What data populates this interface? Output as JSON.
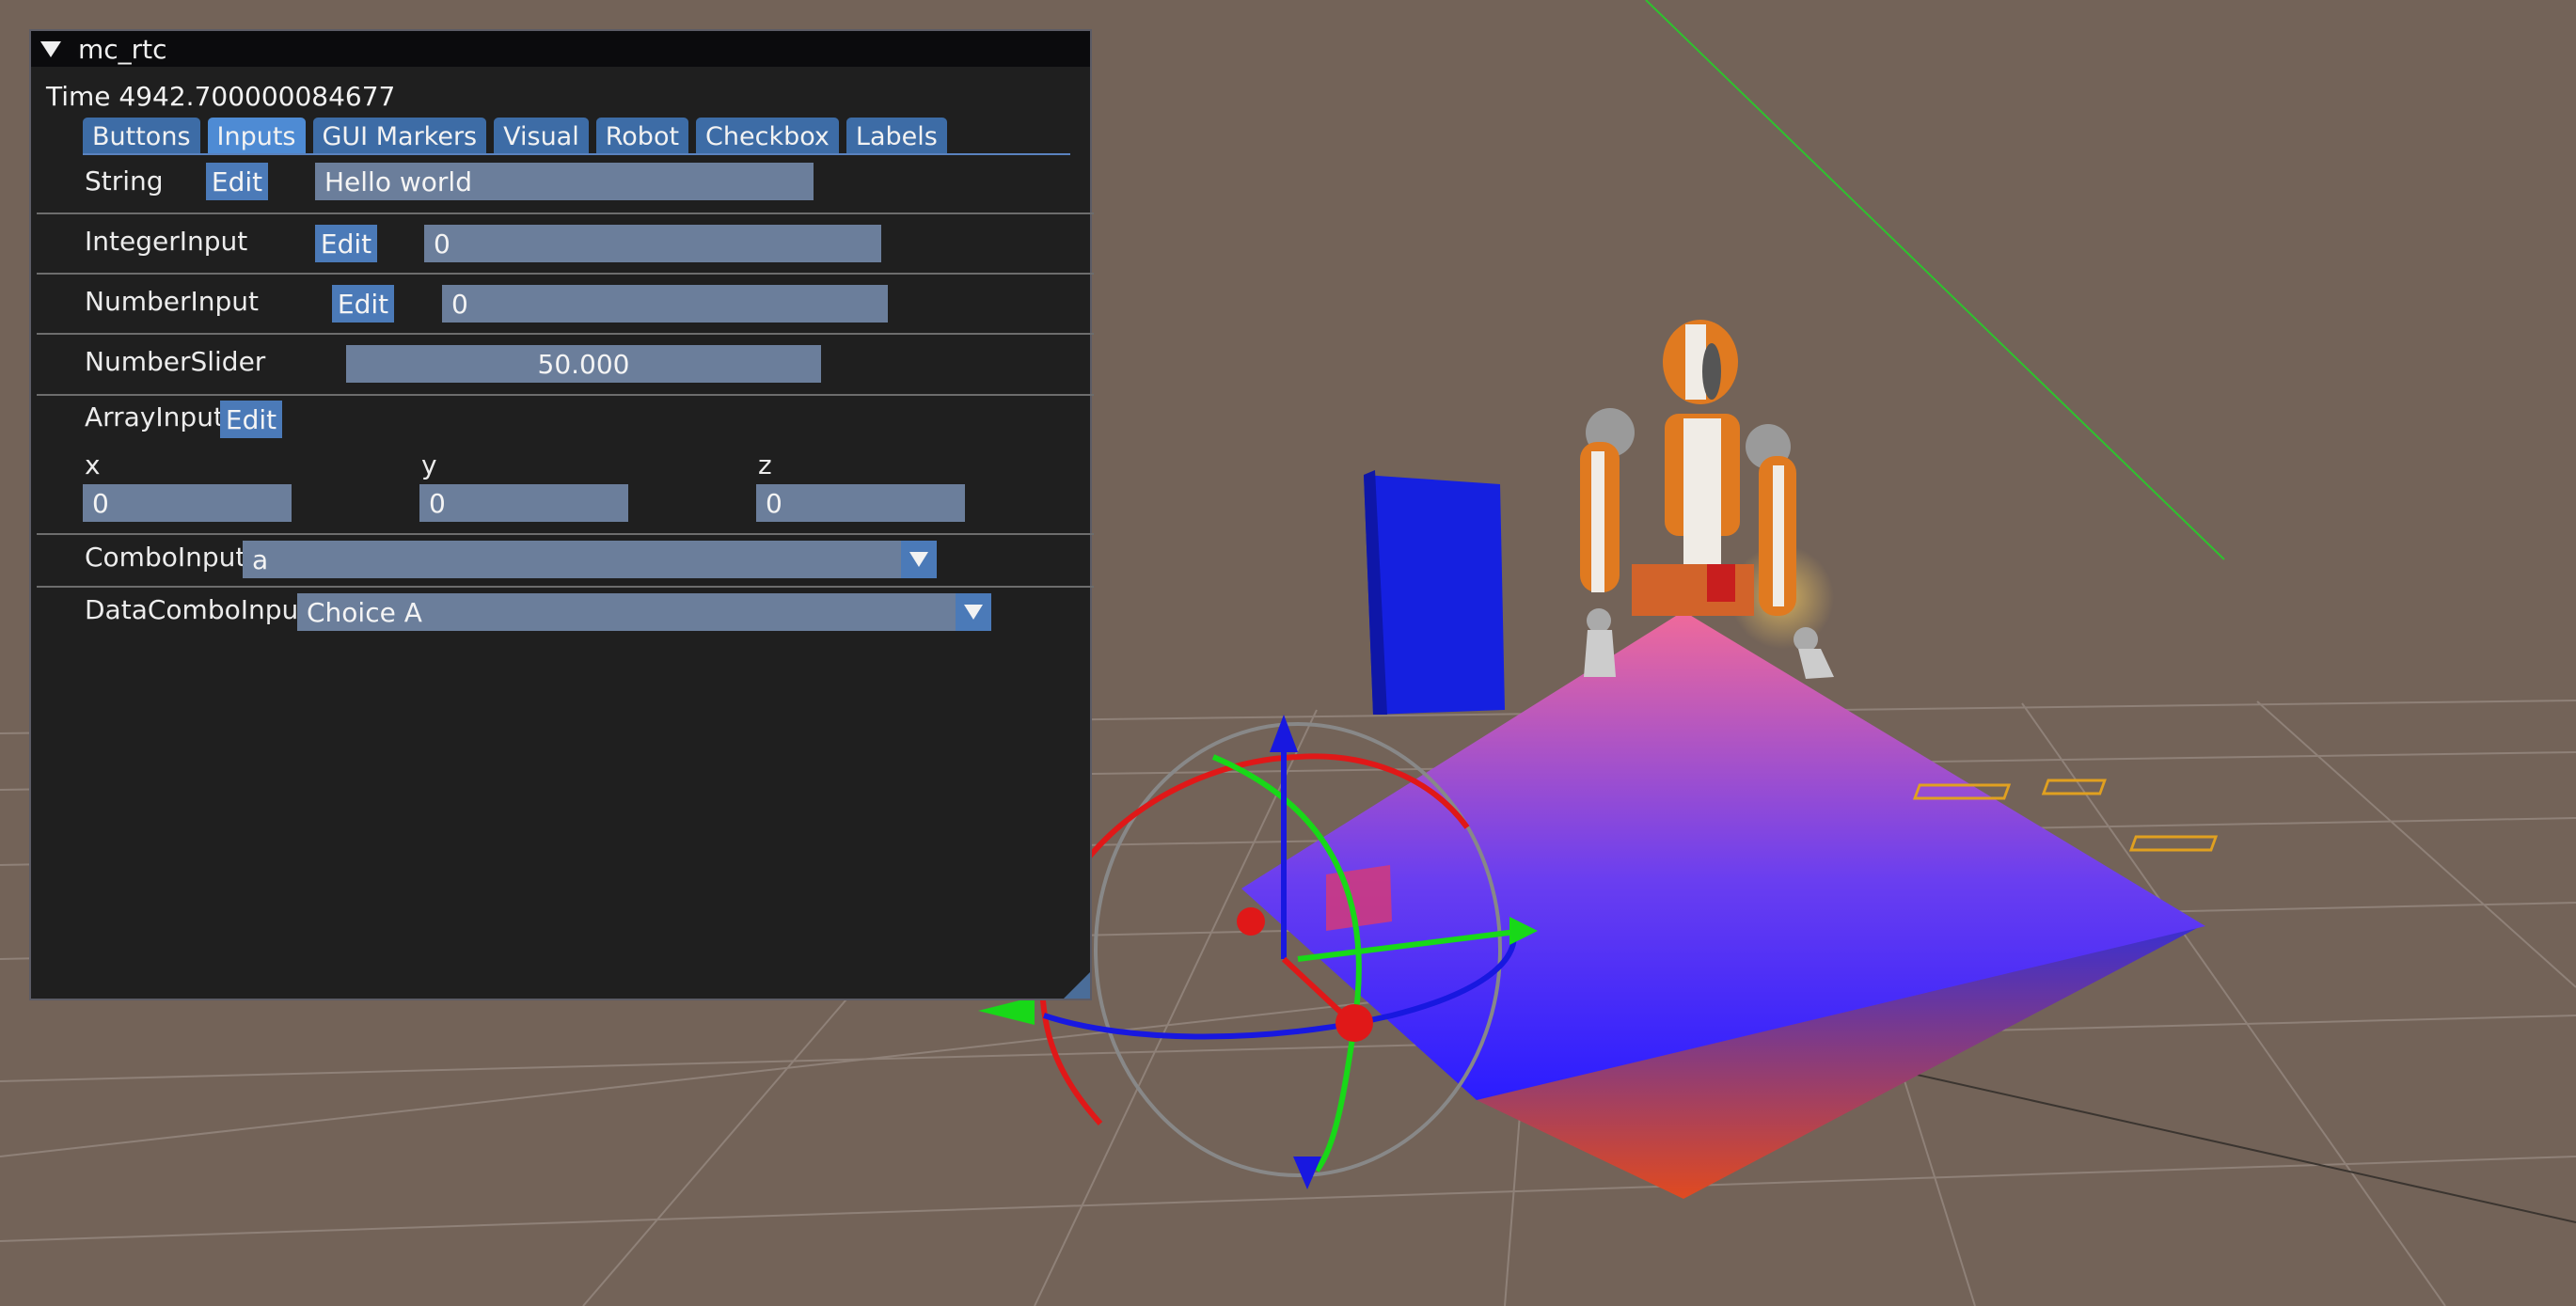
{
  "window": {
    "title": "mc_rtc",
    "time_label": "Time 4942.700000084677"
  },
  "tabs": [
    {
      "label": "Buttons",
      "active": false
    },
    {
      "label": "Inputs",
      "active": true
    },
    {
      "label": "GUI Markers",
      "active": false
    },
    {
      "label": "Visual",
      "active": false
    },
    {
      "label": "Robot",
      "active": false
    },
    {
      "label": "Checkbox",
      "active": false
    },
    {
      "label": "Labels",
      "active": false
    }
  ],
  "inputs": {
    "string": {
      "label": "String",
      "edit": "Edit",
      "value": "Hello world"
    },
    "integer": {
      "label": "IntegerInput",
      "edit": "Edit",
      "value": "0"
    },
    "number": {
      "label": "NumberInput",
      "edit": "Edit",
      "value": "0"
    },
    "slider": {
      "label": "NumberSlider",
      "value": "50.000"
    },
    "array": {
      "label": "ArrayInput",
      "edit": "Edit",
      "fields": [
        {
          "label": "x",
          "value": "0"
        },
        {
          "label": "y",
          "value": "0"
        },
        {
          "label": "z",
          "value": "0"
        }
      ]
    },
    "combo": {
      "label": "ComboInput",
      "value": "a"
    },
    "data_combo": {
      "label": "DataComboInput",
      "value": "Choice A"
    }
  },
  "scene": {
    "background_color": "#736358",
    "objects": [
      "robot",
      "blue-box",
      "gradient-plane",
      "transform-gizmo",
      "ground-grid"
    ]
  }
}
